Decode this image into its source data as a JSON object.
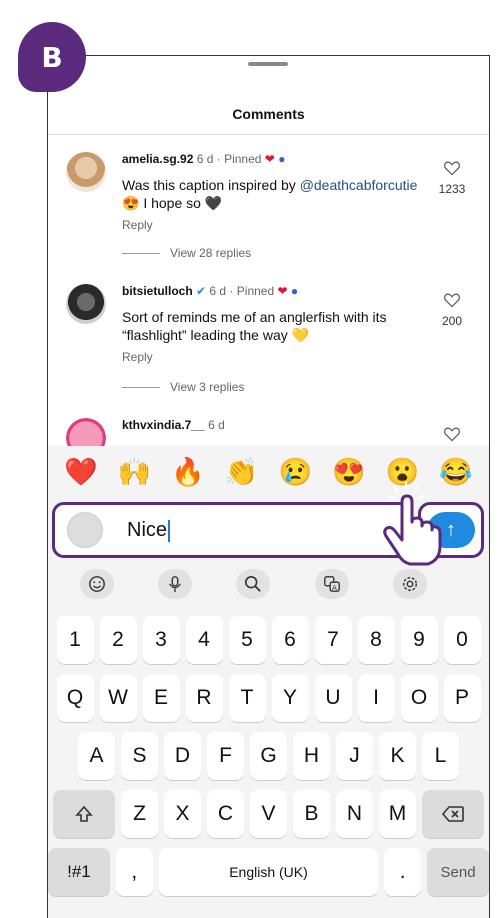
{
  "badge": {
    "label": "B"
  },
  "header": {
    "title": "Comments"
  },
  "comments": [
    {
      "username": "amelia.sg.92",
      "meta": "6 d · Pinned",
      "text_pre": "Was this caption inspired by ",
      "mention": "@deathcabforcutie",
      "text_post": " 😍 I hope so 🖤",
      "reply": "Reply",
      "view_replies": "View 28 replies",
      "likes": "1233"
    },
    {
      "username": "bitsietulloch",
      "meta": "6 d · Pinned",
      "text": "Sort of reminds me of an anglerfish with its “flashlight” leading the way 💛",
      "reply": "Reply",
      "view_replies": "View 3 replies",
      "likes": "200"
    },
    {
      "username": "kthvxindia.7__",
      "meta": "6 d"
    }
  ],
  "emojis": [
    "❤️",
    "🙌",
    "🔥",
    "👏",
    "😢",
    "😍",
    "😮",
    "😂"
  ],
  "input": {
    "value": "Nice"
  },
  "send_icon": "↑",
  "toolbar_icons": [
    "smile-icon",
    "mic-icon",
    "search-icon",
    "translate-icon",
    "settings-icon"
  ],
  "keyboard": {
    "row1": [
      "1",
      "2",
      "3",
      "4",
      "5",
      "6",
      "7",
      "8",
      "9",
      "0"
    ],
    "row2": [
      "Q",
      "W",
      "E",
      "R",
      "T",
      "Y",
      "U",
      "I",
      "O",
      "P"
    ],
    "row3": [
      "A",
      "S",
      "D",
      "F",
      "G",
      "H",
      "J",
      "K",
      "L"
    ],
    "row4": [
      "Z",
      "X",
      "C",
      "V",
      "B",
      "N",
      "M"
    ],
    "symbols": "!#1",
    "comma": ",",
    "space": "English (UK)",
    "period": ".",
    "send": "Send"
  }
}
